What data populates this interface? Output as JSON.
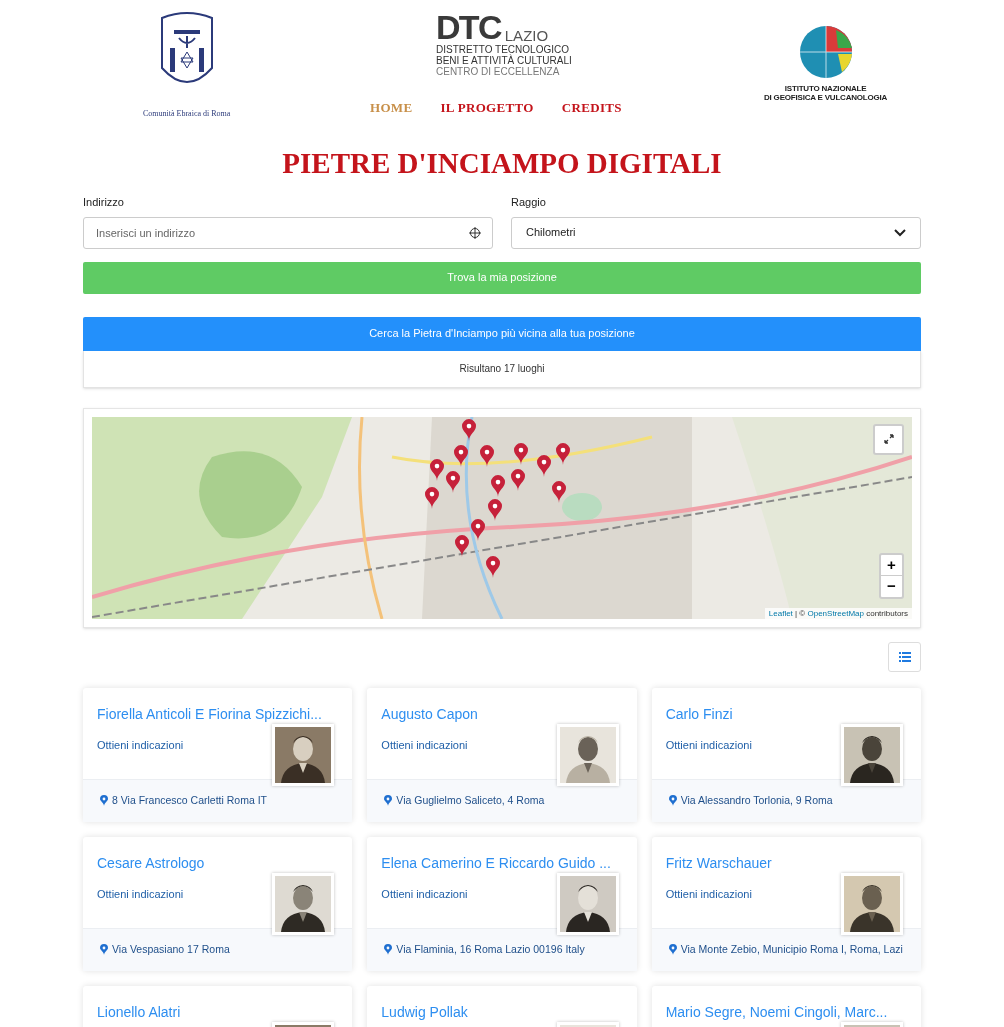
{
  "header": {
    "left_logo": {
      "caption": "Comunità Ebraica di Roma"
    },
    "center_logo": {
      "mark": "DTC",
      "region": "LAZIO",
      "lines": [
        "DISTRETTO TECNOLOGICO",
        "BENI E ATTIVITÀ CULTURALI",
        "CENTRO DI ECCELLENZA"
      ]
    },
    "right_logo": {
      "lines": [
        "ISTITUTO NAZIONALE",
        "DI GEOFISICA E VULCANOLOGIA"
      ]
    }
  },
  "nav": [
    {
      "label": "HOME",
      "selected": true
    },
    {
      "label": "IL PROGETTO",
      "selected": false
    },
    {
      "label": "CREDITS",
      "selected": false
    }
  ],
  "title": "PIETRE D'INCIAMPO DIGITALI",
  "address": {
    "label": "Indirizzo",
    "placeholder": "Inserisci un indirizzo"
  },
  "radius": {
    "label": "Raggio",
    "value": "Chilometri"
  },
  "locate_button": "Trova la mia posizione",
  "nearest_button": "Cerca la Pietra d'Inciampo più vicina alla tua posizione",
  "results": "Risultano 17 luoghi",
  "map": {
    "kind": "picture",
    "zoom_in": "+",
    "zoom_out": "−",
    "attribution": {
      "link": "Leaflet",
      "separator": " | © ",
      "source": "OpenStreetMap",
      "suffix": " contributors"
    }
  },
  "cards": [
    {
      "name": "Fiorella Anticoli E Fiorina Spizzichi...",
      "link": "Ottieni indicazioni",
      "address": "8 Via Francesco Carletti Roma IT"
    },
    {
      "name": "Augusto Capon",
      "link": "Ottieni indicazioni",
      "address": "Via Guglielmo Saliceto, 4 Roma"
    },
    {
      "name": "Carlo Finzi",
      "link": "Ottieni indicazioni",
      "address": "Via Alessandro Torlonia, 9 Roma"
    },
    {
      "name": "Cesare Astrologo",
      "link": "Ottieni indicazioni",
      "address": "Via Vespasiano 17 Roma"
    },
    {
      "name": "Elena Camerino E Riccardo Guido ...",
      "link": "Ottieni indicazioni",
      "address": "Via Flaminia, 16 Roma Lazio 00196 Italy"
    },
    {
      "name": "Fritz Warschauer",
      "link": "Ottieni indicazioni",
      "address": "Via Monte Zebio, Municipio Roma I, Roma, Lazi"
    },
    {
      "name": "Lionello Alatri"
    },
    {
      "name": "Ludwig Pollak"
    },
    {
      "name": "Mario Segre, Noemi Cingoli, Marc..."
    }
  ]
}
